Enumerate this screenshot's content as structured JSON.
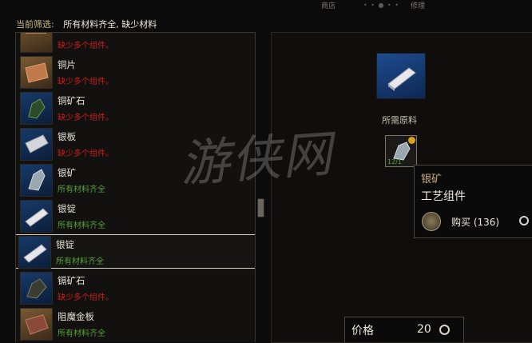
{
  "top": {
    "tab_shop": "商店",
    "tab_repair": "修理",
    "dots": "• • ● • •"
  },
  "filter": {
    "label": "当前筛选:",
    "value": "所有材料齐全, 缺少材料"
  },
  "items": [
    {
      "name": "",
      "status": "缺少多个组件。",
      "ok": false,
      "thumb": "brown",
      "icon": "partial-item-icon"
    },
    {
      "name": "铜片",
      "status": "缺少多个组件。",
      "ok": false,
      "thumb": "brown",
      "icon": "copper-sheet-icon"
    },
    {
      "name": "铜矿石",
      "status": "缺少多个组件。",
      "ok": false,
      "thumb": "blue",
      "icon": "copper-ore-icon"
    },
    {
      "name": "银板",
      "status": "缺少多个组件。",
      "ok": false,
      "thumb": "blue",
      "icon": "silver-plate-icon"
    },
    {
      "name": "银矿",
      "status": "所有材料齐全",
      "ok": true,
      "thumb": "blue",
      "icon": "silver-ore-icon"
    },
    {
      "name": "银锭",
      "status": "所有材料齐全",
      "ok": true,
      "thumb": "blue",
      "icon": "silver-ingot-icon"
    },
    {
      "name": "银锭",
      "status": "所有材料齐全",
      "ok": true,
      "thumb": "blue",
      "icon": "silver-ingot-icon",
      "selected": true
    },
    {
      "name": "镉矿石",
      "status": "缺少多个组件。",
      "ok": false,
      "thumb": "blue",
      "icon": "cadmium-ore-icon"
    },
    {
      "name": "阻魔金板",
      "status": "所有材料齐全",
      "ok": true,
      "thumb": "brown",
      "icon": "dimeritium-plate-icon"
    }
  ],
  "detail": {
    "required_label": "所需原料",
    "slot_count": "12/1"
  },
  "tooltip": {
    "title": "银矿",
    "subtitle": "工艺组件",
    "buy": "购买 (136)"
  },
  "price": {
    "label": "价格",
    "value": "20"
  },
  "watermark": "游侠网",
  "colors": {
    "missing": "#c8201a",
    "complete": "#58a13a",
    "accent": "#c9a97a"
  }
}
